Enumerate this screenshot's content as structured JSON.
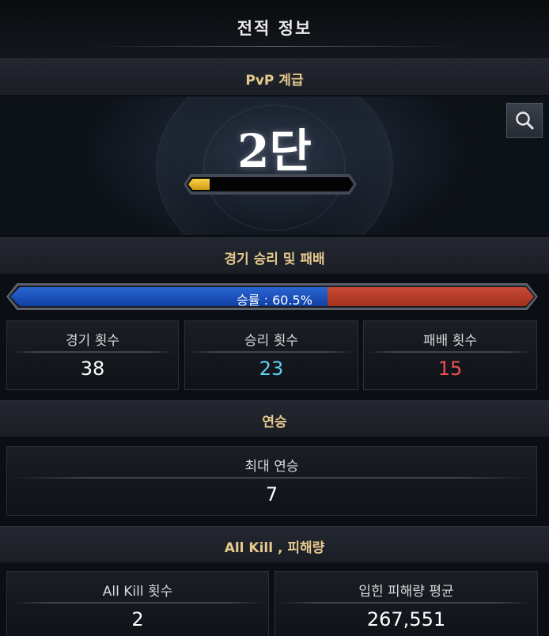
{
  "page": {
    "title": "전적 정보"
  },
  "rank": {
    "header": "PvP 계급",
    "rank_text": "2단",
    "progress_fraction": 0.13,
    "search_icon": "search-icon"
  },
  "results": {
    "header": "경기 승리 및 패배",
    "win_rate_label": "승률 : 60.5%",
    "win_rate": 0.605,
    "stats": [
      {
        "label": "경기 횟수",
        "value": "38"
      },
      {
        "label": "승리 횟수",
        "value": "23"
      },
      {
        "label": "패배 횟수",
        "value": "15"
      }
    ]
  },
  "streak": {
    "header": "연승",
    "label": "최대 연승",
    "value": "7"
  },
  "allkill": {
    "header": "All Kill , 피해량",
    "stats": [
      {
        "label": "All Kill 횟수",
        "value": "2"
      },
      {
        "label": "입힌 피해량 평균",
        "value": "267,551"
      }
    ]
  },
  "colors": {
    "accent_gold": "#e6c98c",
    "win_blue": "#5fd0f4",
    "loss_red": "#f05050"
  }
}
